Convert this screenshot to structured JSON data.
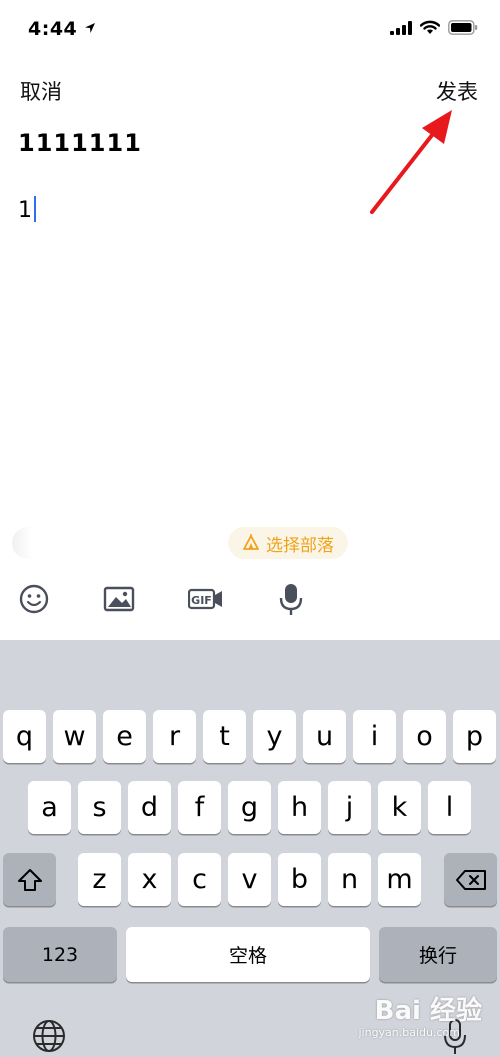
{
  "status_bar": {
    "time": "4:44"
  },
  "nav": {
    "cancel_label": "取消",
    "publish_label": "发表"
  },
  "post": {
    "title": "1111111",
    "body": "1"
  },
  "tribe_chip": {
    "label": "选择部落",
    "accent_color": "#f0a31a"
  },
  "toolbar": {
    "icons": [
      "emoji-icon",
      "image-icon",
      "gif-icon",
      "microphone-icon"
    ]
  },
  "keyboard": {
    "row1": [
      "q",
      "w",
      "e",
      "r",
      "t",
      "y",
      "u",
      "i",
      "o",
      "p"
    ],
    "row2": [
      "a",
      "s",
      "d",
      "f",
      "g",
      "h",
      "j",
      "k",
      "l"
    ],
    "row3": [
      "z",
      "x",
      "c",
      "v",
      "b",
      "n",
      "m"
    ],
    "numbers_label": "123",
    "space_label": "空格",
    "return_label": "换行"
  },
  "watermark": {
    "brand": "Bai 经验",
    "url": "jingyan.baidu.com"
  }
}
